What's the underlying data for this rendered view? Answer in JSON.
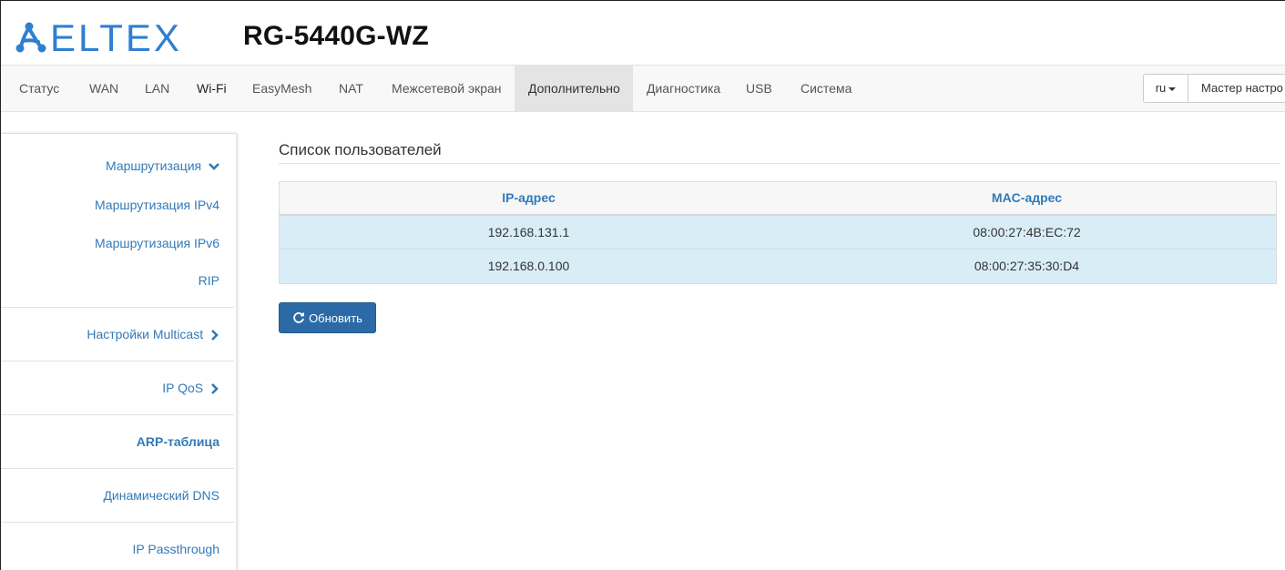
{
  "header": {
    "brand": "ELTEX",
    "model": "RG-5440G-WZ",
    "brand_color": "#2f7fd1"
  },
  "nav": {
    "items": [
      {
        "label": "Статус"
      },
      {
        "label": "WAN"
      },
      {
        "label": "LAN"
      },
      {
        "label": "Wi-Fi"
      },
      {
        "label": "EasyMesh"
      },
      {
        "label": "NAT"
      },
      {
        "label": "Межсетевой экран"
      },
      {
        "label": "Дополнительно",
        "active": true
      },
      {
        "label": "Диагностика"
      },
      {
        "label": "USB"
      },
      {
        "label": "Система"
      }
    ],
    "language": "ru",
    "wizard_label": "Мастер настро"
  },
  "sidebar": {
    "routing_header": "Маршрутизация",
    "routing_ipv4": "Маршрутизация IPv4",
    "routing_ipv6": "Маршрутизация IPv6",
    "rip": "RIP",
    "multicast": "Настройки Multicast",
    "ip_qos": "IP QoS",
    "arp_table": "ARP-таблица",
    "dynamic_dns": "Динамический DNS",
    "ip_passthrough": "IP Passthrough"
  },
  "main": {
    "title": "Список пользователей",
    "columns": {
      "ip": "IP-адрес",
      "mac": "MAC-адрес"
    },
    "rows": [
      {
        "ip": "192.168.131.1",
        "mac": "08:00:27:4B:EC:72"
      },
      {
        "ip": "192.168.0.100",
        "mac": "08:00:27:35:30:D4"
      }
    ],
    "refresh_label": "Обновить"
  },
  "colors": {
    "link": "#337ab7",
    "row_highlight": "#d9edf7",
    "primary_button": "#2b6aa6"
  }
}
